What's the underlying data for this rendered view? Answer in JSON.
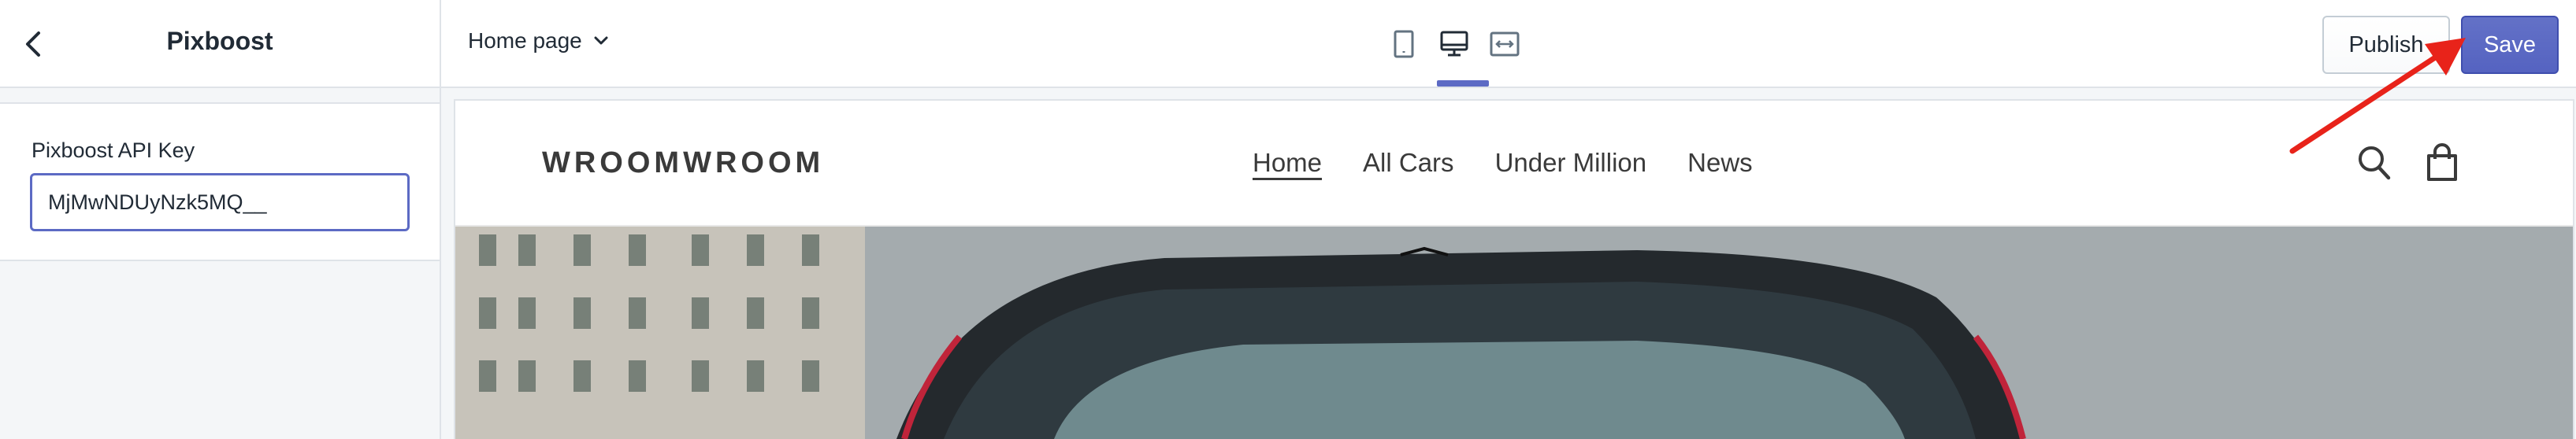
{
  "sidebar": {
    "title": "Pixboost",
    "field_label": "Pixboost API Key",
    "field_value": "MjMwNDUyNzk5MQ__"
  },
  "topbar": {
    "page_selector": "Home page",
    "publish_label": "Publish",
    "save_label": "Save",
    "active_device": "desktop"
  },
  "store": {
    "logo": "WROOMWROOM",
    "nav": [
      "Home",
      "All Cars",
      "Under Million",
      "News"
    ],
    "active_nav": "Home"
  },
  "colors": {
    "accent": "#5c6ac4",
    "annotation_arrow": "#e8231a"
  }
}
